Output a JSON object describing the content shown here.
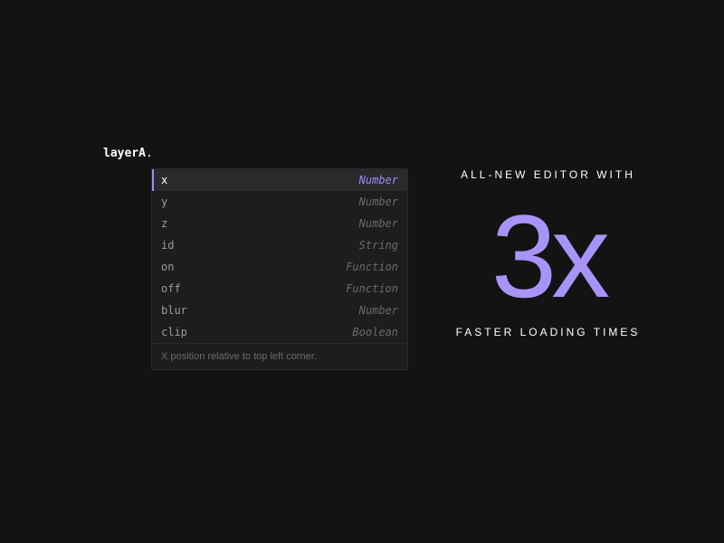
{
  "code": {
    "object": "layerA",
    "dot": "."
  },
  "autocomplete": {
    "items": [
      {
        "name": "x",
        "type": "Number",
        "selected": true
      },
      {
        "name": "y",
        "type": "Number",
        "selected": false
      },
      {
        "name": "z",
        "type": "Number",
        "selected": false
      },
      {
        "name": "id",
        "type": "String",
        "selected": false
      },
      {
        "name": "on",
        "type": "Function",
        "selected": false
      },
      {
        "name": "off",
        "type": "Function",
        "selected": false
      },
      {
        "name": "blur",
        "type": "Number",
        "selected": false
      },
      {
        "name": "clip",
        "type": "Boolean",
        "selected": false
      }
    ],
    "hint": "X position relative to top left corner."
  },
  "promo": {
    "line1": "ALL-NEW EDITOR WITH",
    "big": "3x",
    "line2": "FASTER LOADING TIMES"
  }
}
